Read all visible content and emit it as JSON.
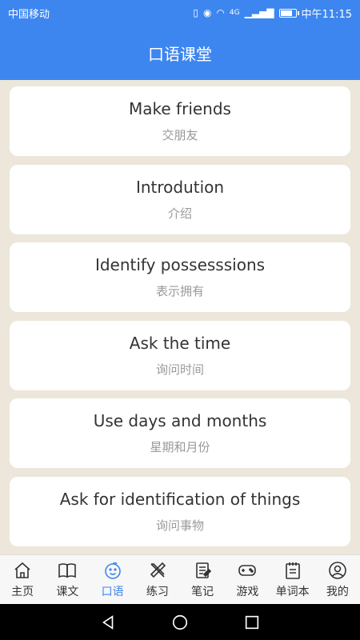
{
  "status_bar": {
    "carrier": "中国移动",
    "signal_label": "4G",
    "time": "中午11:15",
    "battery_level": 0.85
  },
  "header": {
    "title": "口语课堂"
  },
  "lessons": [
    {
      "title": "Make friends",
      "subtitle": "交朋友"
    },
    {
      "title": "Introdution",
      "subtitle": "介绍"
    },
    {
      "title": "Identify possesssions",
      "subtitle": "表示拥有"
    },
    {
      "title": "Ask the time",
      "subtitle": "询问时间"
    },
    {
      "title": "Use days and months",
      "subtitle": "星期和月份"
    },
    {
      "title": "Ask for identification of things",
      "subtitle": "询问事物"
    }
  ],
  "tabbar": {
    "active_color": "#3d86f0",
    "items": [
      {
        "label": "主页",
        "icon": "home-icon"
      },
      {
        "label": "课文",
        "icon": "book-icon"
      },
      {
        "label": "口语",
        "icon": "smile-face-icon",
        "active": true
      },
      {
        "label": "练习",
        "icon": "pencil-ruler-icon"
      },
      {
        "label": "笔记",
        "icon": "notebook-icon"
      },
      {
        "label": "游戏",
        "icon": "gamepad-icon"
      },
      {
        "label": "单词本",
        "icon": "calendar-notebook-icon"
      },
      {
        "label": "我的",
        "icon": "user-icon"
      }
    ]
  }
}
